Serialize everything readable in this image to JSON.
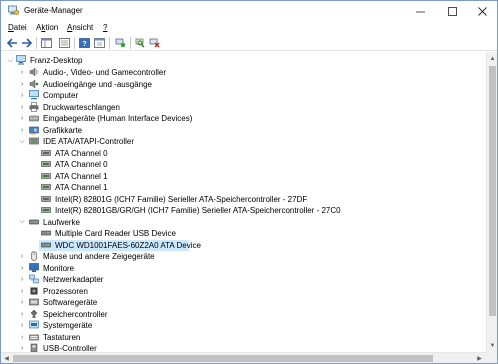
{
  "window": {
    "title": "Geräte-Manager"
  },
  "menu": [
    {
      "pre": "",
      "ul": "D",
      "post": "atei"
    },
    {
      "pre": "A",
      "ul": "k",
      "post": "tion"
    },
    {
      "pre": "",
      "ul": "A",
      "post": "nsicht"
    },
    {
      "pre": "",
      "ul": "?",
      "post": ""
    }
  ],
  "toolbar": [
    "back-icon",
    "forward-icon",
    "show-hide-console-tree-icon",
    "properties-icon",
    "help-icon",
    "update-driver-icon",
    "monitor-icon",
    "scan-hardware-icon",
    "uninstall-device-icon"
  ],
  "tree": {
    "root": "Franz-Desktop",
    "categories": {
      "audio": "Audio-, Video- und Gamecontroller",
      "audio_io": "Audioeingänge und -ausgänge",
      "computer": "Computer",
      "print_queues": "Druckwarteschlangen",
      "hid": "Eingabegeräte (Human Interface Devices)",
      "graphics": "Grafikkarte",
      "ide": "IDE ATA/ATAPI-Controller",
      "drives": "Laufwerke",
      "mice": "Mäuse und andere Zeigegeräte",
      "monitors": "Monitore",
      "network": "Netzwerkadapter",
      "processors": "Prozessoren",
      "software": "Softwaregeräte",
      "storage": "Speichercontroller",
      "system": "Systemgeräte",
      "keyboards": "Tastaturen",
      "usb": "USB-Controller"
    },
    "ide_children": [
      "ATA Channel 0",
      "ATA Channel 0",
      "ATA Channel 1",
      "ATA Channel 1",
      "Intel(R) 82801G (ICH7 Familie) Serieller ATA-Speichercontroller - 27DF",
      "Intel(R) 82801GB/GR/GH (ICH7 Familie) Serieller ATA-Speichercontroller - 27C0"
    ],
    "drive_children": [
      "Multiple Card  Reader USB Device",
      "WDC WD1001FAES-60Z2A0 ATA Device"
    ]
  },
  "colors": {
    "selection": "#cce8ff",
    "accent": "#0078d7"
  }
}
